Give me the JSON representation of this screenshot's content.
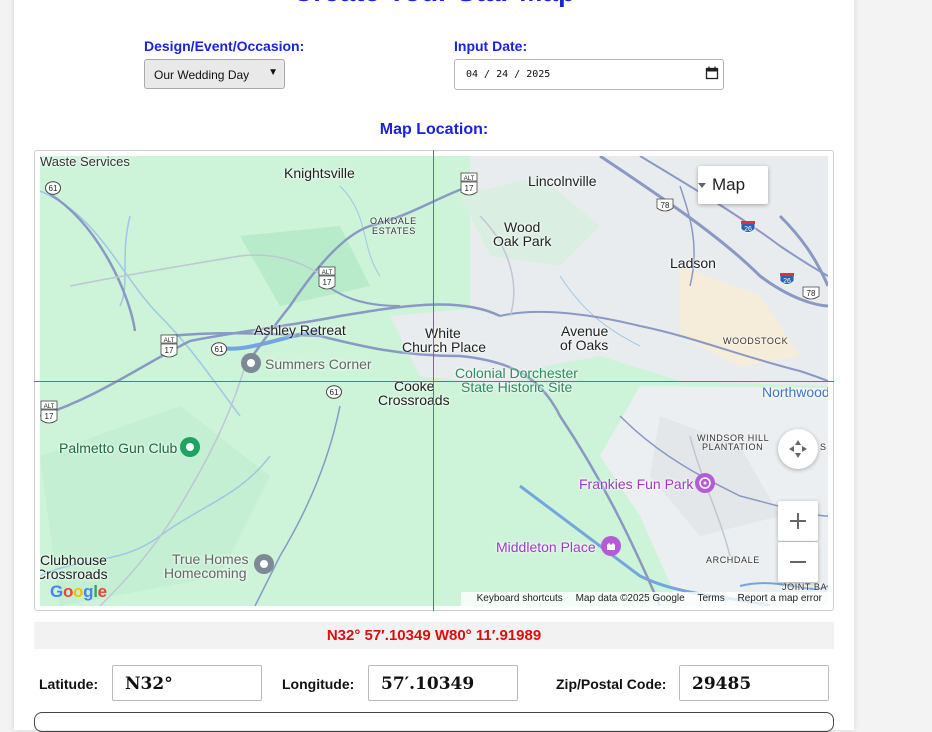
{
  "page": {
    "title": "Create Your Star Map"
  },
  "design": {
    "label": "Design/Event/Occasion:",
    "selected": "Our Wedding Day"
  },
  "date": {
    "label": "Input Date:",
    "value": "04 / 24 / 2025"
  },
  "map": {
    "section_label": "Map Location:",
    "map_type_label": "Map",
    "attribution": {
      "shortcuts": "Keyboard shortcuts",
      "data": "Map data ©2025 Google",
      "terms": "Terms",
      "report": "Report a map error"
    },
    "logo_text": "Google",
    "places": {
      "waste_services": "Waste Services",
      "knightsville": "Knightsville",
      "lincolnville": "Lincolnville",
      "oakdale_1": "OAKDALE",
      "oakdale_2": "ESTATES",
      "wood_oak_1": "Wood",
      "wood_oak_2": "Oak Park",
      "ladson": "Ladson",
      "ashley_retreat": "Ashley Retreat",
      "white_church_1": "White",
      "white_church_2": "Church Place",
      "avenue_oaks_1": "Avenue",
      "avenue_oaks_2": "of Oaks",
      "woodstock": "WOODSTOCK",
      "summers_corner": "Summers Corner",
      "colonial_1": "Colonial Dorchester",
      "colonial_2": "State Historic Site",
      "cooke_1": "Cooke",
      "cooke_2": "Crossroads",
      "northwood": "Northwood",
      "windsor_1": "WINDSOR HILL",
      "windsor_2": "PLANTATION",
      "palmetto": "Palmetto Gun Club",
      "frankies": "Frankies Fun Park",
      "clubhouse_1": "Clubhouse",
      "clubhouse_2": "Crossroads",
      "true_homes_1": "True Homes",
      "true_homes_2": "Homecoming",
      "middleton": "Middleton Place",
      "archdale": "ARCHDALE",
      "joint_base": "JOINT BA",
      "s_edge": "S"
    },
    "shields": {
      "r61a": "61",
      "alt17a": "ALT",
      "r17a": "17",
      "r78a": "78",
      "r26a": "26",
      "r26b": "26",
      "r78b": "78",
      "alt17b": "ALT",
      "r17b": "17",
      "alt17c": "ALT",
      "r17c": "17",
      "r61b": "61",
      "r61c": "61",
      "alt17d": "ALT",
      "r17d": "17"
    }
  },
  "coordinates": {
    "display": "N32° 57′.10349 W80° 11′.91989"
  },
  "fields": {
    "latitude": {
      "label": "Latitude:",
      "value": "N32°"
    },
    "longitude": {
      "label": "Longitude:",
      "value": "57′.10349"
    },
    "zip": {
      "label": "Zip/Postal Code:",
      "value": "29485"
    }
  },
  "colors": {
    "accent_blue": "#1a22e0",
    "coord_red": "#e00d0d",
    "map_green": "#cdf3d9",
    "road_blue": "#8a98c4"
  }
}
